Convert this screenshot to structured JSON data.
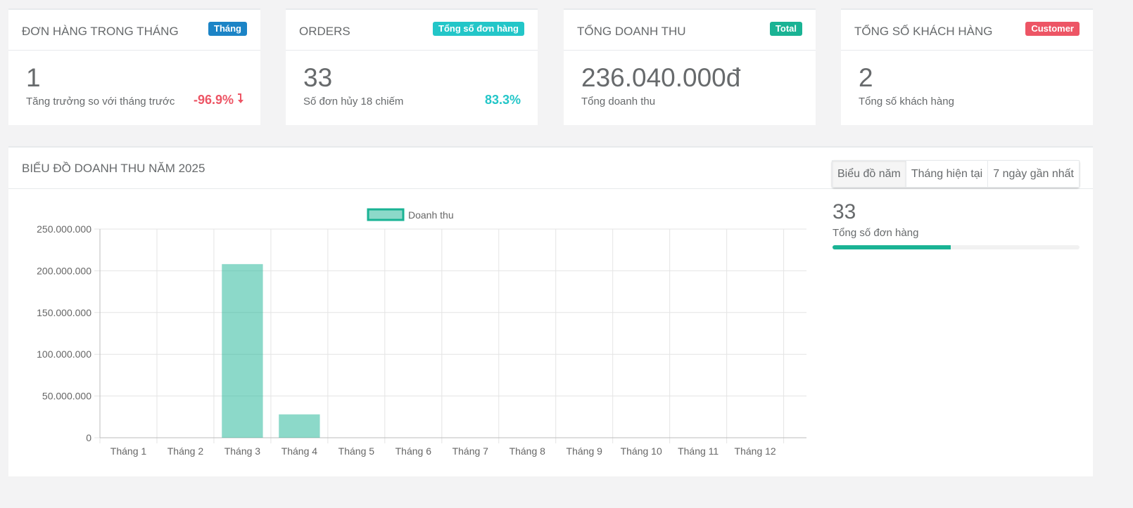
{
  "cards": [
    {
      "title": "ĐƠN HÀNG TRONG THÁNG",
      "badge": "Tháng",
      "badge_color": "#1c84c6",
      "value": "1",
      "sub": "Tăng trưởng so với tháng trước",
      "side": "-96.9%",
      "side_color": "#ed5565",
      "side_icon": "arrow-down-icon"
    },
    {
      "title": "ORDERS",
      "badge": "Tổng số đơn hàng",
      "badge_color": "#23c6c8",
      "value": "33",
      "sub": "Số đơn hủy 18 chiếm",
      "side": "83.3%",
      "side_color": "#23c6c8"
    },
    {
      "title": "TỔNG DOANH THU",
      "badge": "Total",
      "badge_color": "#1ab394",
      "value": "236.040.000đ",
      "sub": "Tổng doanh thu"
    },
    {
      "title": "TỔNG SỐ KHÁCH HÀNG",
      "badge": "Customer",
      "badge_color": "#ed5565",
      "value": "2",
      "sub": "Tổng số khách hàng"
    }
  ],
  "chart_panel": {
    "title": "BIỂU ĐỒ DOANH THU NĂM 2025",
    "buttons": [
      "Biểu đồ năm",
      "Tháng hiện tại",
      "7 ngày gần nhất"
    ],
    "active_button": 0
  },
  "stats": {
    "value": "33",
    "label": "Tổng số đơn hàng",
    "progress": 0.48,
    "progress_color": "#1ab394"
  },
  "chart_data": {
    "type": "bar",
    "categories": [
      "Tháng 1",
      "Tháng 2",
      "Tháng 3",
      "Tháng 4",
      "Tháng 5",
      "Tháng 6",
      "Tháng 7",
      "Tháng 8",
      "Tháng 9",
      "Tháng 10",
      "Tháng 11",
      "Tháng 12"
    ],
    "series": [
      {
        "name": "Doanh thu",
        "values": [
          0,
          0,
          208000000,
          28000000,
          0,
          0,
          0,
          0,
          0,
          0,
          0,
          0
        ],
        "color": "#1ab394"
      }
    ],
    "ylim": [
      0,
      250000000
    ],
    "yticks": [
      0,
      50000000,
      100000000,
      150000000,
      200000000,
      250000000
    ],
    "ytick_labels": [
      "0",
      "50.000.000",
      "100.000.000",
      "150.000.000",
      "200.000.000",
      "250.000.000"
    ],
    "grid": true,
    "legend": "top"
  }
}
